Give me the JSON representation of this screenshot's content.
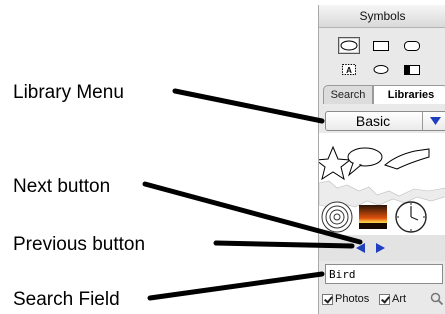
{
  "callouts": {
    "library_menu": "Library Menu",
    "next_button": "Next button",
    "previous_button": "Previous button",
    "search_field": "Search Field"
  },
  "palette": {
    "title": "Symbols",
    "tools": [
      {
        "name": "ellipse-tool",
        "selected": true
      },
      {
        "name": "rectangle-tool",
        "selected": false
      },
      {
        "name": "rounded-rectangle-tool",
        "selected": false
      },
      {
        "name": "text-box-tool",
        "selected": false
      },
      {
        "name": "oval-tool",
        "selected": false
      },
      {
        "name": "gradient-rectangle-tool",
        "selected": false
      }
    ],
    "text_box_glyph": "A",
    "tabs": {
      "search": "Search",
      "libraries": "Libraries",
      "active": "libraries"
    },
    "library_menu": {
      "selected": "Basic"
    },
    "search": {
      "value": "Bird"
    },
    "filters": {
      "photos_label": "Photos",
      "photos_checked": true,
      "art_label": "Art",
      "art_checked": true
    }
  },
  "colors": {
    "accent_arrow": "#1f3fbf",
    "callout_line": "#000000"
  },
  "icons": [
    "star-shape-icon",
    "speech-bubble-icon",
    "spiral-icon",
    "sunset-photo-icon",
    "clock-icon",
    "prev-arrow-icon",
    "next-arrow-icon",
    "magnifier-icon",
    "chevron-down-icon"
  ]
}
